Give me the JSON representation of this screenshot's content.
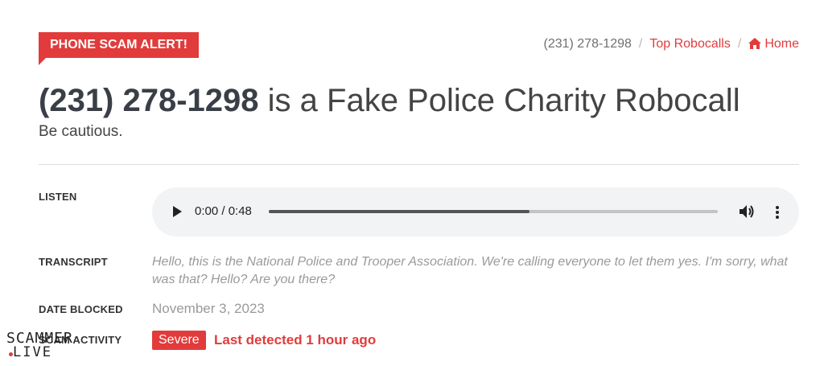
{
  "badge": {
    "text": "PHONE SCAM ALERT!"
  },
  "breadcrumb": {
    "current": "(231) 278-1298",
    "separator": "/",
    "top_robocalls": "Top Robocalls",
    "home": "Home",
    "home_icon": "home-icon"
  },
  "title": {
    "phone": "(231) 278-1298",
    "rest": " is a Fake Police Charity Robocall"
  },
  "subtitle": "Be cautious.",
  "listen": {
    "label": "LISTEN",
    "time": "0:00 / 0:48",
    "progress": 0.58,
    "icons": [
      "play-icon",
      "volume-icon",
      "more-options-icon"
    ]
  },
  "transcript": {
    "label": "TRANSCRIPT",
    "text": "Hello, this is the National Police and Trooper Association. We're calling everyone to let them yes. I'm sorry, what was that? Hello? Are you there?"
  },
  "date_blocked": {
    "label": "DATE BLOCKED",
    "value": "November 3, 2023"
  },
  "activity": {
    "label": "SCAM ACTIVITY",
    "severity": "Severe",
    "detected": "Last detected 1 hour ago"
  },
  "logo": {
    "line1": "SCAMMER",
    "line2": "LIVE"
  },
  "colors": {
    "accent": "#e23b3b",
    "muted": "#9a9a9a",
    "player_bg": "#f1f3f4"
  }
}
